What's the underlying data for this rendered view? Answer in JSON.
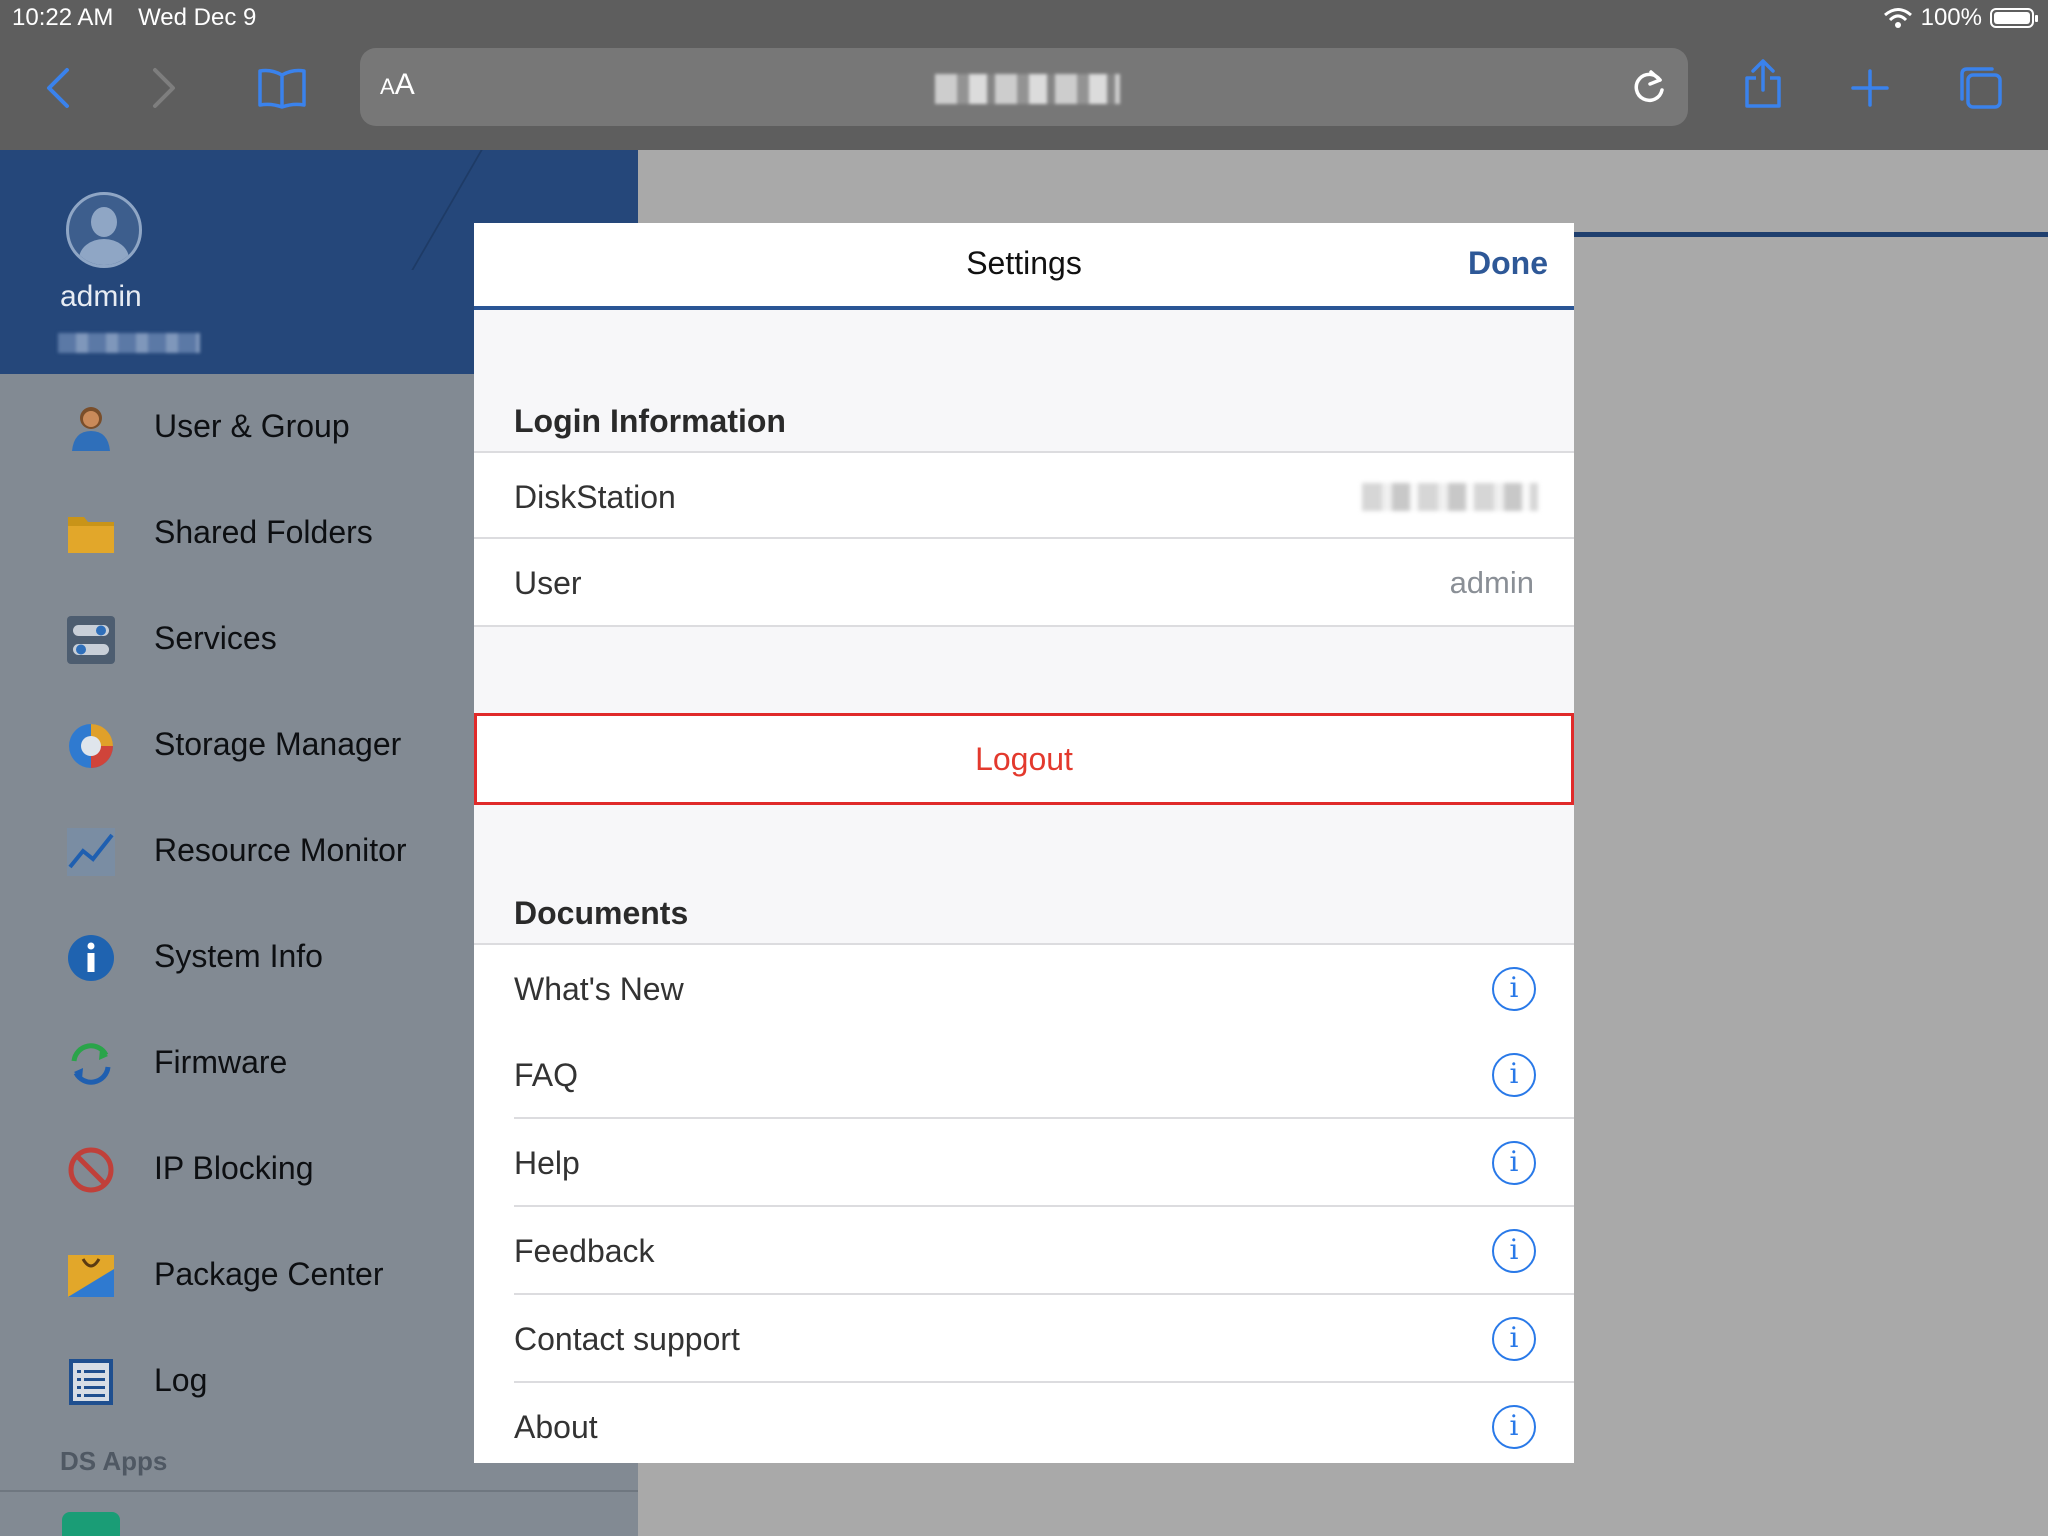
{
  "status_bar": {
    "time": "10:22 AM",
    "date": "Wed Dec 9",
    "battery": "100%"
  },
  "browser": {
    "aa_label_small": "A",
    "aa_label_large": "A",
    "icons": [
      "back-icon",
      "forward-icon",
      "bookmarks-icon",
      "reload-icon",
      "share-icon",
      "new-tab-icon",
      "tabs-icon"
    ]
  },
  "sidebar": {
    "user_name": "admin",
    "items": [
      {
        "label": "User & Group",
        "icon": "user-group-icon"
      },
      {
        "label": "Shared Folders",
        "icon": "folder-icon"
      },
      {
        "label": "Services",
        "icon": "services-icon"
      },
      {
        "label": "Storage Manager",
        "icon": "storage-icon"
      },
      {
        "label": "Resource Monitor",
        "icon": "resource-monitor-icon"
      },
      {
        "label": "System Info",
        "icon": "info-icon"
      },
      {
        "label": "Firmware",
        "icon": "firmware-icon"
      },
      {
        "label": "IP Blocking",
        "icon": "ip-blocking-icon"
      },
      {
        "label": "Package Center",
        "icon": "package-center-icon"
      },
      {
        "label": "Log",
        "icon": "log-icon"
      }
    ],
    "section_label": "DS Apps"
  },
  "settings": {
    "title": "Settings",
    "done_label": "Done",
    "login_section": "Login Information",
    "diskstation_label": "DiskStation",
    "user_label": "User",
    "user_value": "admin",
    "logout_label": "Logout",
    "documents_section": "Documents",
    "documents": [
      "What's New",
      "FAQ",
      "Help",
      "Feedback",
      "Contact support",
      "About"
    ],
    "info_glyph": "i"
  },
  "colors": {
    "accent": "#2e5897",
    "logout": "#e3392d",
    "highlight_border": "#e02a2a",
    "info": "#2979e8"
  }
}
